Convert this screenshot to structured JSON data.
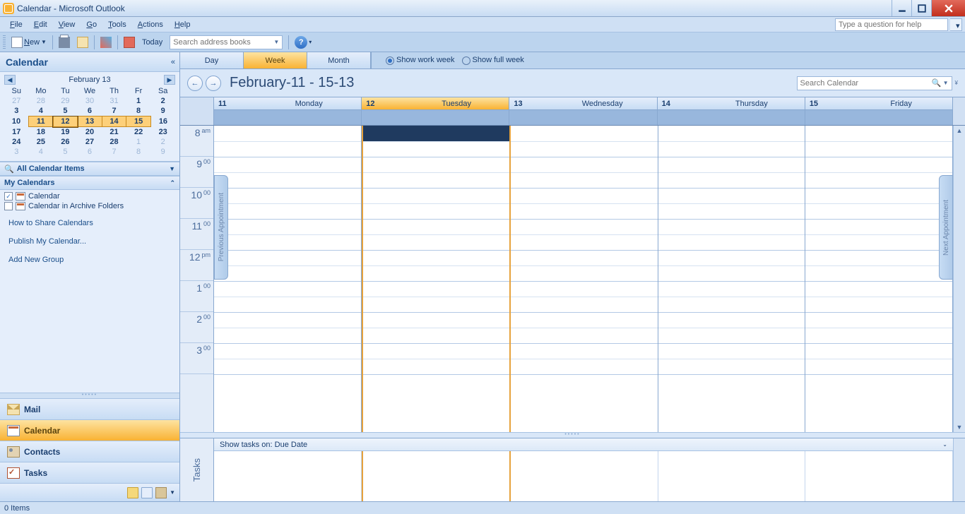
{
  "window": {
    "title": "Calendar - Microsoft Outlook"
  },
  "menubar": {
    "file": "File",
    "edit": "Edit",
    "view": "View",
    "go": "Go",
    "tools": "Tools",
    "actions": "Actions",
    "help": "Help",
    "helpbox_placeholder": "Type a question for help"
  },
  "toolbar": {
    "new": "New",
    "today": "Today",
    "search_placeholder": "Search address books"
  },
  "nav": {
    "title": "Calendar",
    "minical": {
      "month_label": "February 13",
      "dow": [
        "Su",
        "Mo",
        "Tu",
        "We",
        "Th",
        "Fr",
        "Sa"
      ],
      "rows": [
        [
          "27",
          "28",
          "29",
          "30",
          "31",
          "1",
          "2"
        ],
        [
          "3",
          "4",
          "5",
          "6",
          "7",
          "8",
          "9"
        ],
        [
          "10",
          "11",
          "12",
          "13",
          "14",
          "15",
          "16"
        ],
        [
          "17",
          "18",
          "19",
          "20",
          "21",
          "22",
          "23"
        ],
        [
          "24",
          "25",
          "26",
          "27",
          "28",
          "1",
          "2"
        ],
        [
          "3",
          "4",
          "5",
          "6",
          "7",
          "8",
          "9"
        ]
      ]
    },
    "allitems": "All Calendar Items",
    "mycals": "My Calendars",
    "cal1": "Calendar",
    "cal2": "Calendar in Archive Folders",
    "link_share": "How to Share Calendars",
    "link_publish": "Publish My Calendar...",
    "link_add": "Add New Group",
    "btn_mail": "Mail",
    "btn_cal": "Calendar",
    "btn_contacts": "Contacts",
    "btn_tasks": "Tasks"
  },
  "view": {
    "tab_day": "Day",
    "tab_week": "Week",
    "tab_month": "Month",
    "show_work": "Show work week",
    "show_full": "Show full week",
    "date_range": "February-11 - 15-13",
    "search_placeholder": "Search Calendar",
    "days": [
      {
        "num": "11",
        "name": "Monday"
      },
      {
        "num": "12",
        "name": "Tuesday"
      },
      {
        "num": "13",
        "name": "Wednesday"
      },
      {
        "num": "14",
        "name": "Thursday"
      },
      {
        "num": "15",
        "name": "Friday"
      }
    ],
    "today_index": 1,
    "hours": [
      {
        "h": "8",
        "m": "am"
      },
      {
        "h": "9",
        "m": "00"
      },
      {
        "h": "10",
        "m": "00"
      },
      {
        "h": "11",
        "m": "00"
      },
      {
        "h": "12",
        "m": "pm"
      },
      {
        "h": "1",
        "m": "00"
      },
      {
        "h": "2",
        "m": "00"
      },
      {
        "h": "3",
        "m": "00"
      }
    ],
    "prev_appt": "Previous Appointment",
    "next_appt": "Next Appointment"
  },
  "tasks": {
    "header": "Show tasks on: Due Date",
    "label": "Tasks"
  },
  "status": {
    "items": "0 Items"
  }
}
